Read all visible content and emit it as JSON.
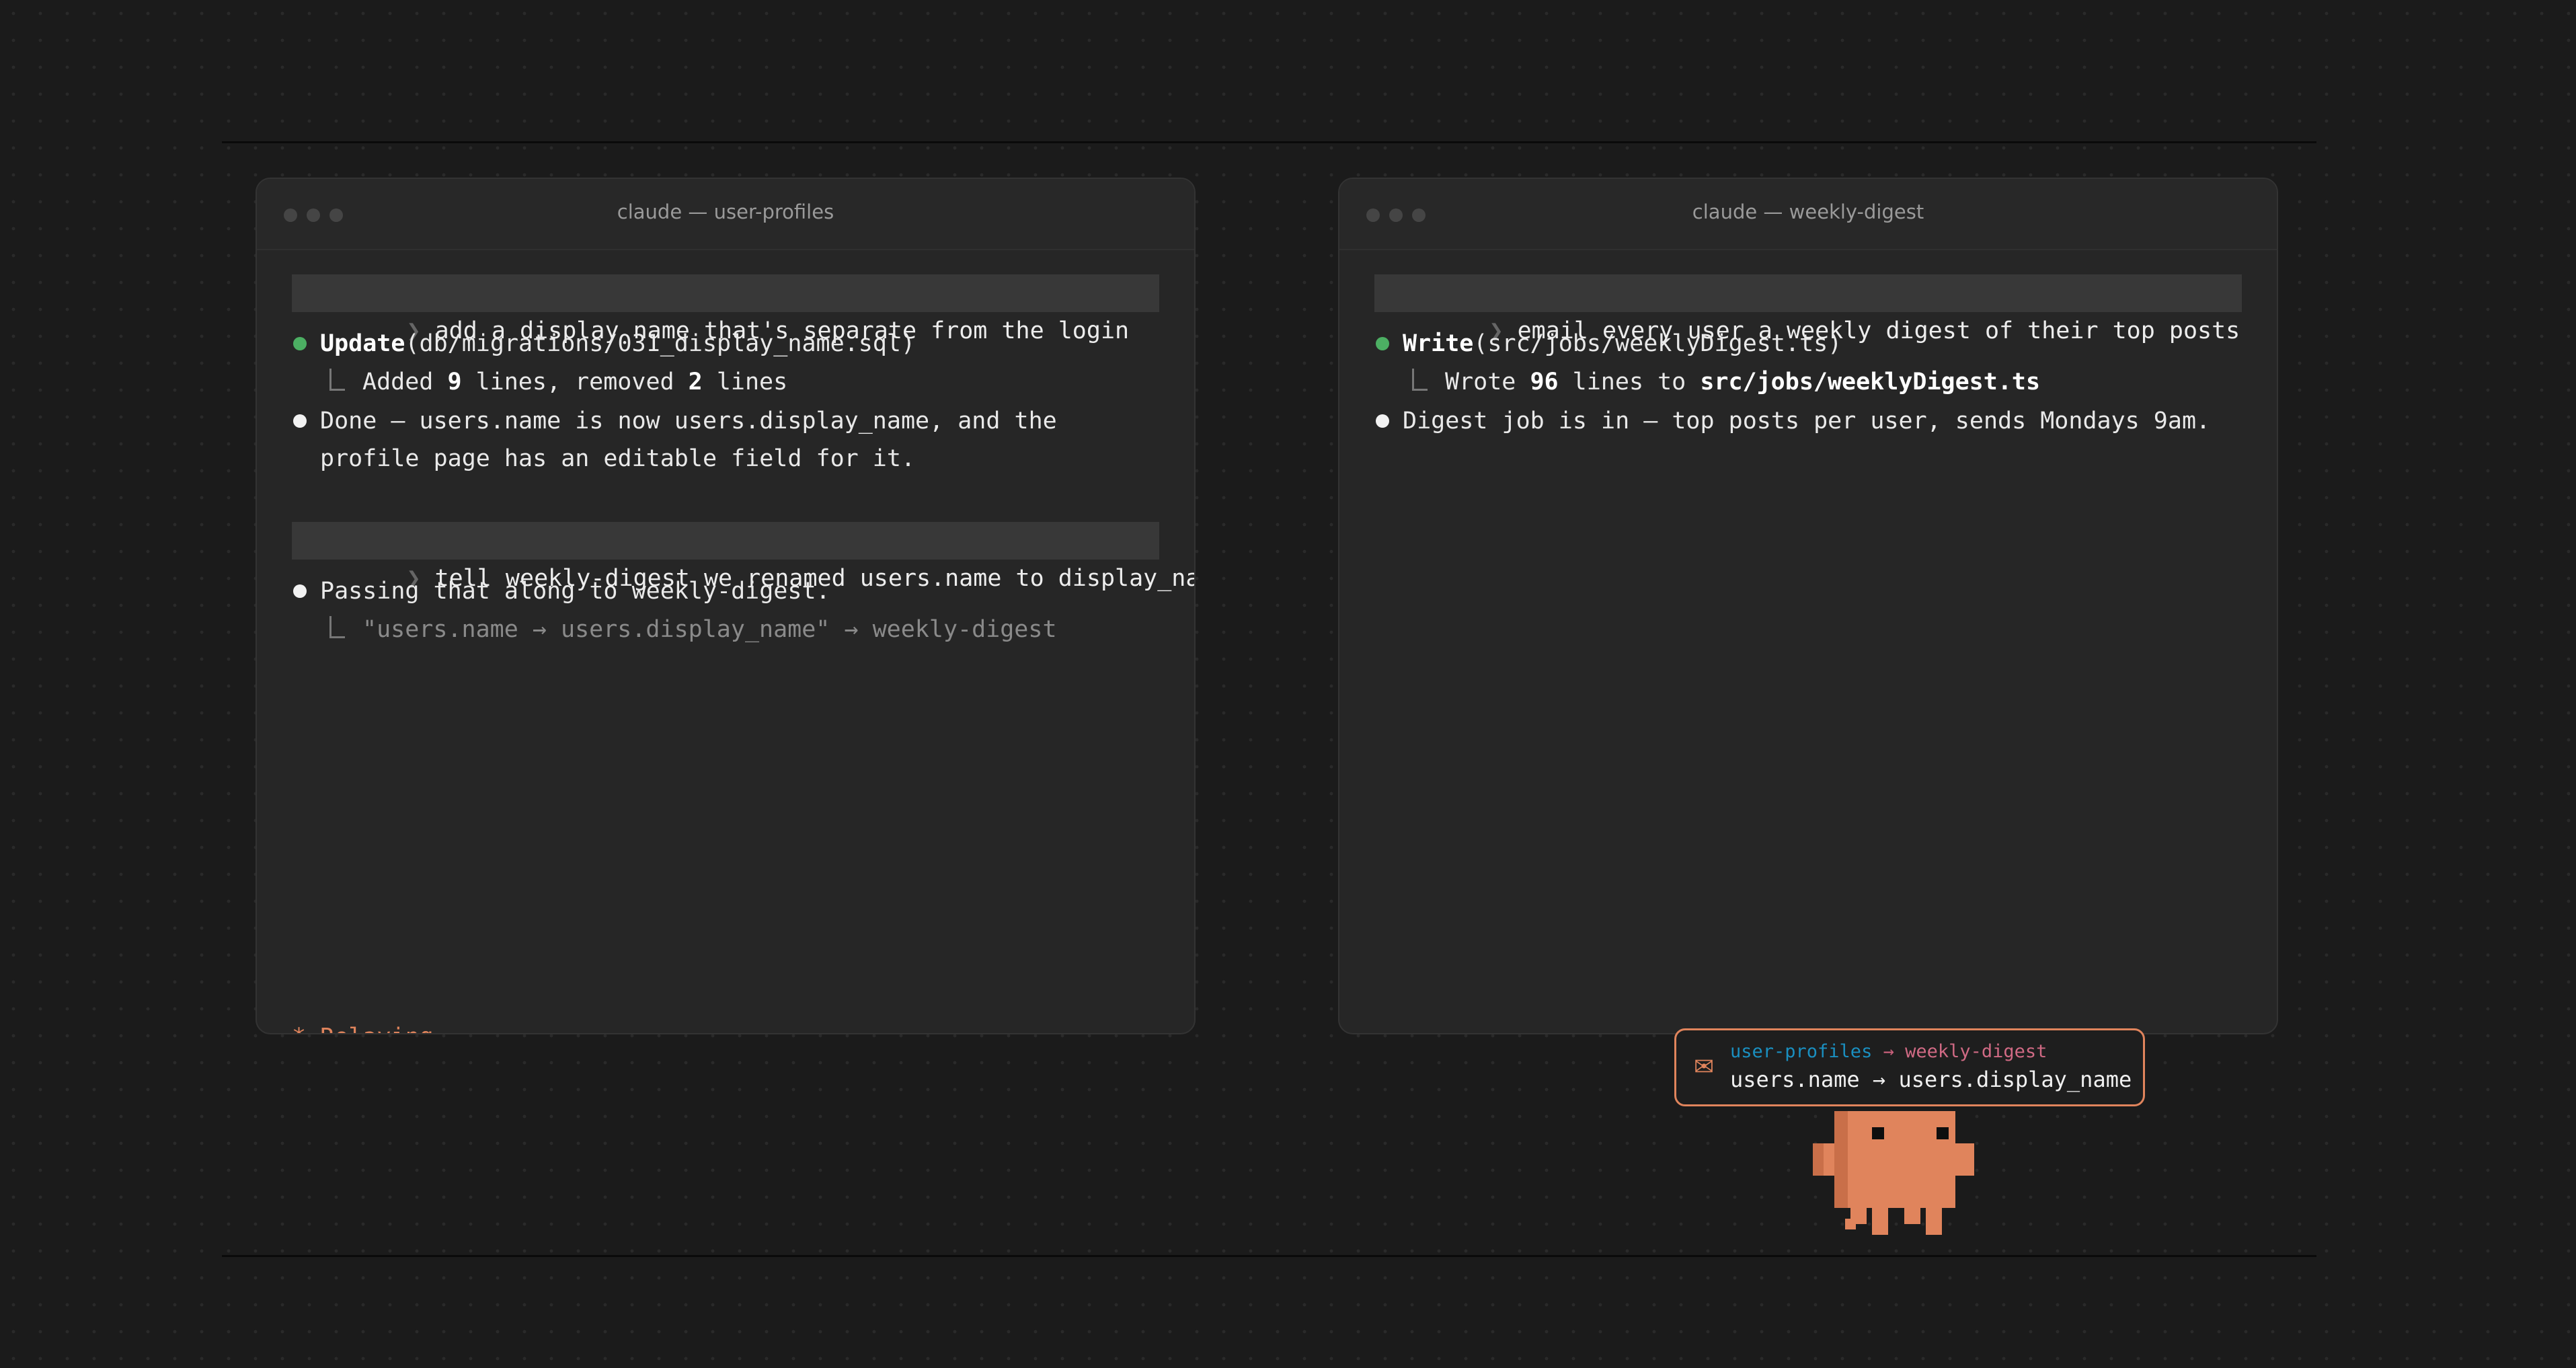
{
  "colors": {
    "background": "#1b1b1b",
    "terminal_bg": "#262626",
    "accent_orange": "#e0845c",
    "user_profiles_blue": "#0a86b8",
    "weekly_digest_pink": "#d26a85",
    "success_green": "#4caf63"
  },
  "left_terminal": {
    "title": "claude — user-profiles",
    "prompt_caret": "❯",
    "prompt1": "add a display name that's separate from the login",
    "update_tool": "Update",
    "update_args": "(db/migrations/031_display_name.sql)",
    "update_result_pre": "Added ",
    "update_added": "9",
    "update_result_mid": " lines, removed ",
    "update_removed": "2",
    "update_result_post": " lines",
    "done_line1": "Done — users.name is now users.display_name, and the",
    "done_line2": "profile page has an editable field for it.",
    "prompt2": "tell weekly-digest we renamed users.name to display_name",
    "passing": "Passing that along to weekly-digest.",
    "relay_detail": "\"users.name → users.display_name\" → weekly-digest",
    "status": "* Relaying…",
    "tag": "user-profiles",
    "input_caret": "❯"
  },
  "right_terminal": {
    "title": "claude — weekly-digest",
    "prompt_caret": "❯",
    "prompt1": "email every user a weekly digest of their top posts",
    "write_tool": "Write",
    "write_args": "(src/jobs/weeklyDigest.ts)",
    "write_result_pre": "Wrote ",
    "write_count": "96",
    "write_result_mid": " lines to ",
    "write_path": "src/jobs/weeklyDigest.ts",
    "digest_line": "Digest job is in — top posts per user, sends Mondays 9am.",
    "tag": "weekly-digest",
    "input_caret": "❯"
  },
  "message": {
    "icon": "envelope-icon",
    "envelope_glyph": "✉",
    "from": "user-profiles",
    "arrow": " → ",
    "to": "weekly-digest",
    "body": "users.name → users.display_name"
  },
  "mascot": {
    "icon": "pixel-mascot-icon"
  }
}
